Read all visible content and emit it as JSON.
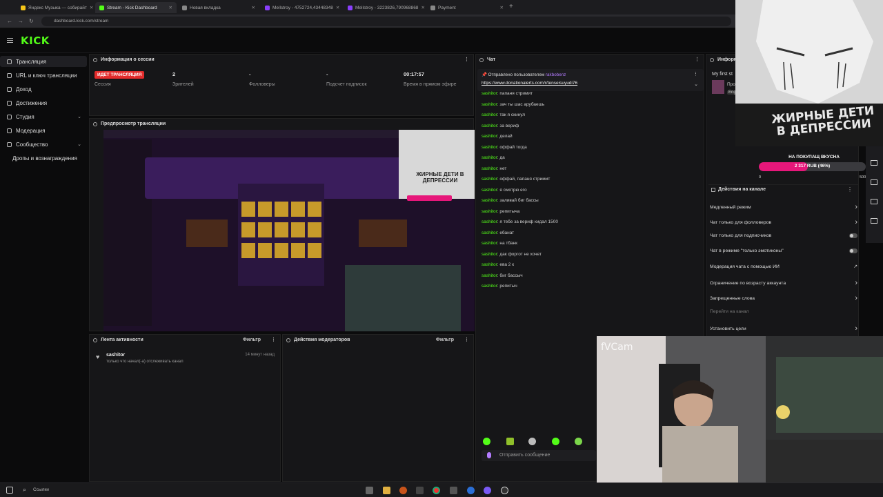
{
  "browser": {
    "tabs": [
      {
        "label": "Яндекс Музыка — собирайт",
        "color": "#f5c518"
      },
      {
        "label": "Stream - Kick Dashboard",
        "color": "#53fc18"
      },
      {
        "label": "Новая вкладка",
        "color": "#888888"
      },
      {
        "label": "Mellstroy - 4752724,43448348",
        "color": "#8a3ffc"
      },
      {
        "label": "Mellstroy - 3223826,790968868",
        "color": "#8a3ffc"
      },
      {
        "label": "Payment",
        "color": "#888888"
      }
    ],
    "url": "dashboard.kick.com/stream"
  },
  "kick": {
    "logo": "KICK"
  },
  "sidebar": {
    "items": [
      {
        "label": "Трансляция",
        "icon": "broadcast-icon"
      },
      {
        "label": "URL и ключ трансляции",
        "icon": "key-icon"
      },
      {
        "label": "Доход",
        "icon": "wallet-icon"
      },
      {
        "label": "Достижения",
        "icon": "trophy-icon"
      },
      {
        "label": "Студия",
        "icon": "studio-icon"
      },
      {
        "label": "Модерация",
        "icon": "shield-icon"
      },
      {
        "label": "Сообщество",
        "icon": "community-icon"
      },
      {
        "label": "Дропы и вознаграждения",
        "icon": "gift-icon"
      }
    ]
  },
  "session": {
    "title": "Информация о сессии",
    "live_badge": "ИДЕТ ТРАНСЛЯЦИЯ",
    "session_label": "Сессия",
    "viewers_value": "2",
    "viewers_label": "Зрителей",
    "followers_value": "-",
    "followers_label": "Фолловеры",
    "subs_value": "-",
    "subs_label": "Подсчет подписок",
    "uptime_value": "00:17:57",
    "uptime_label": "Время в прямом эфире"
  },
  "preview": {
    "title": "Предпросмотр трансляции",
    "overlay_text": "ЖИРНЫЕ ДЕТИ В ДЕПРЕССИИ"
  },
  "activity": {
    "title": "Лента активности",
    "filter": "Фильтр",
    "user": "sashitor",
    "desc": "только что начал(-а) отслеживать канал",
    "time": "14 минут назад"
  },
  "mod_actions": {
    "title": "Действия модераторов",
    "filter": "Фильтр"
  },
  "chat": {
    "title": "Чат",
    "pinned_by": "Отправлено пользователем",
    "pinned_user": "rakbobenz",
    "pinned_link": "https://www.donationalerts.com/r/tenseisuyudi76",
    "messages": [
      {
        "user": "sashitor",
        "text": "папаня стримит"
      },
      {
        "user": "sashitor",
        "text": "зач ты шас арубаешь"
      },
      {
        "user": "sashitor",
        "text": "так я скинул"
      },
      {
        "user": "sashitor",
        "text": "за вериф"
      },
      {
        "user": "sashitor",
        "text": "делай"
      },
      {
        "user": "sashitor",
        "text": "оффай тогда"
      },
      {
        "user": "sashitor",
        "text": "да"
      },
      {
        "user": "sashitor",
        "text": "нет"
      },
      {
        "user": "sashitor",
        "text": "оффай, папаня стримит"
      },
      {
        "user": "sashitor",
        "text": "я смотрю его"
      },
      {
        "user": "sashitor",
        "text": "заливай биг бассы"
      },
      {
        "user": "sashitor",
        "text": "репитыча"
      },
      {
        "user": "sashitor",
        "text": "я тебе за вериф кидал 1500"
      },
      {
        "user": "sashitor",
        "text": "ебанат"
      },
      {
        "user": "sashitor",
        "text": "на тбанк"
      },
      {
        "user": "sashitor",
        "text": "дак форгот не хочет"
      },
      {
        "user": "sashitor",
        "text": "ева 2 к"
      },
      {
        "user": "sashitor",
        "text": "биг бассыч"
      },
      {
        "user": "sashitor",
        "text": "репитыч"
      }
    ],
    "input_placeholder": "Отправить сообщение"
  },
  "right_panel": {
    "info_title": "Информ",
    "stream_title": "My first st",
    "stream_sub1": "Про",
    "stream_sub2": "Eng",
    "goal_title": "НА ПОКУПАЩ ВКУСНА",
    "goal_amount": "2 317 RUB (46%)",
    "goal_start": "0",
    "goal_end": "5000",
    "goal_progress": 0.46,
    "actions_title": "Действия на канале",
    "actions": [
      {
        "label": "Медленный режим",
        "control": "chevron"
      },
      {
        "label": "Чат только для фолловеров",
        "control": "chevron"
      },
      {
        "label": "Чат только для подписчиков",
        "control": "toggle"
      },
      {
        "label": "Чат в режиме \"только эмотиконы\"",
        "control": "toggle"
      },
      {
        "label": "Модерация чата с помощью ИИ",
        "control": "external"
      },
      {
        "label": "Ограничение по возрасту аккаунта",
        "control": "chevron"
      },
      {
        "label": "Запрещенные слова",
        "control": "chevron"
      },
      {
        "label": "Перейти на канал",
        "control": "none"
      },
      {
        "label": "Установить цели",
        "control": "chevron"
      }
    ]
  },
  "overlay": {
    "caption": "ЖИРНЫЕ ДЕТИ В ДЕПРЕССИИ",
    "webcam_label": "fVCam"
  },
  "taskbar": {
    "search_label": "Ссылки"
  },
  "colors": {
    "kick_green": "#53fc18",
    "live_red": "#e32c2c",
    "goal_pink": "#e6177a"
  }
}
